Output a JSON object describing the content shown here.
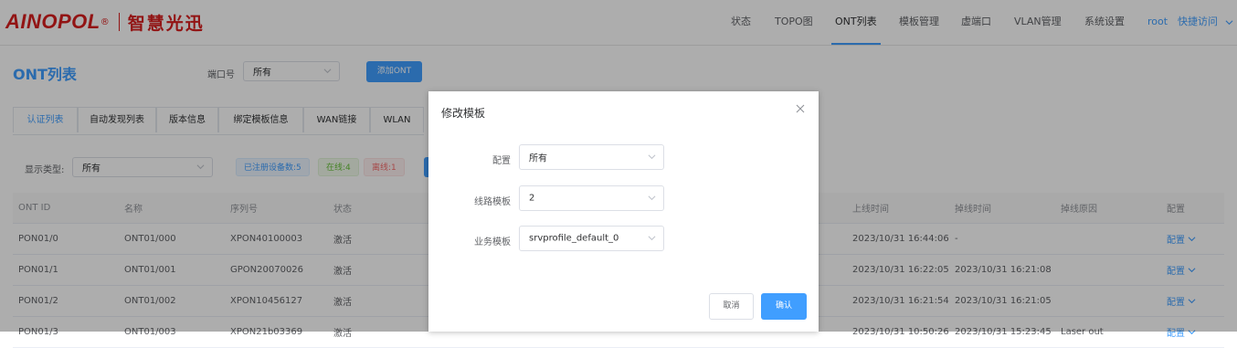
{
  "header": {
    "brand": "AINOPOL",
    "brand_mark": "®",
    "brand_cn": "智慧光迅",
    "nav": [
      "状态",
      "TOPO图",
      "ONT列表",
      "模板管理",
      "虚端口",
      "VLAN管理",
      "系统设置"
    ],
    "active_nav": "ONT列表",
    "user": "root",
    "quick_access": "快捷访问"
  },
  "page": {
    "title": "ONT列表",
    "port_label": "端口号",
    "port_value": "所有",
    "add_button": "添加ONT"
  },
  "tabs": [
    "认证列表",
    "自动发现列表",
    "版本信息",
    "绑定模板信息",
    "WAN链接",
    "WLAN"
  ],
  "active_tab": "认证列表",
  "filter": {
    "type_label": "显示类型:",
    "type_value": "所有",
    "registered": "已注册设备数:5",
    "online": "在线:4",
    "offline": "离线:1"
  },
  "table": {
    "columns": [
      "ONT ID",
      "名称",
      "序列号",
      "状态",
      "上线时间",
      "掉线时间",
      "掉线原因",
      "配置"
    ],
    "rows": [
      {
        "id": "PON01/0",
        "name": "ONT01/000",
        "sn": "XPON40100003",
        "status": "激活",
        "online": "2023/10/31 16:44:06",
        "offline": "-",
        "reason": "",
        "config": "配置"
      },
      {
        "id": "PON01/1",
        "name": "ONT01/001",
        "sn": "GPON20070026",
        "status": "激活",
        "online": "2023/10/31 16:22:05",
        "offline": "2023/10/31 16:21:08",
        "reason": "",
        "config": "配置"
      },
      {
        "id": "PON01/2",
        "name": "ONT01/002",
        "sn": "XPON10456127",
        "status": "激活",
        "online": "2023/10/31 16:21:54",
        "offline": "2023/10/31 16:21:05",
        "reason": "",
        "config": "配置"
      },
      {
        "id": "PON01/3",
        "name": "ONT01/003",
        "sn": "XPON21b03369",
        "status": "激活",
        "online": "2023/10/31 10:50:26",
        "offline": "2023/10/31 15:23:45",
        "reason": "Laser out",
        "config": "配置"
      }
    ]
  },
  "dialog": {
    "title": "修改模板",
    "close_icon": "close-icon",
    "fields": [
      {
        "label": "配置",
        "value": "所有"
      },
      {
        "label": "线路模板",
        "value": "2"
      },
      {
        "label": "业务模板",
        "value": "srvprofile_default_0"
      }
    ],
    "cancel": "取消",
    "confirm": "确认"
  },
  "colors": {
    "accent": "#409eff",
    "brand": "#d81e1e",
    "overlay": "rgba(0,0,0,0.32)"
  }
}
